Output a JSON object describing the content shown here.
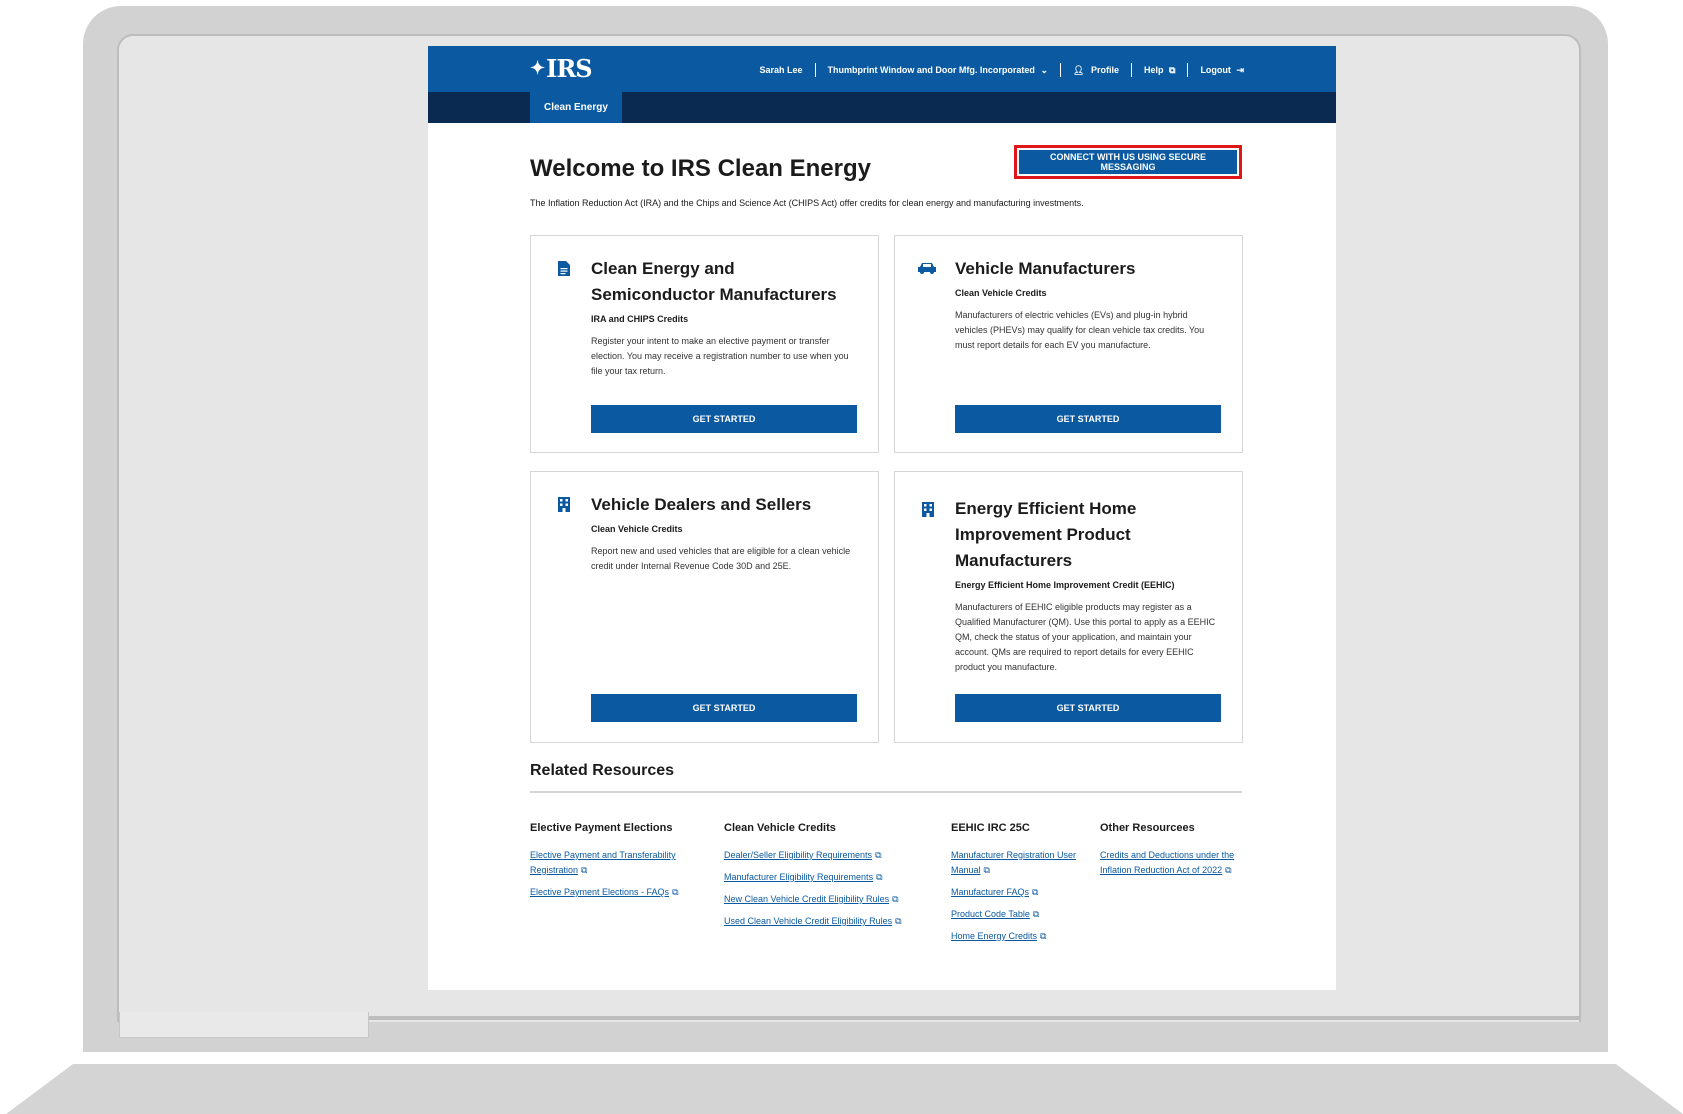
{
  "header": {
    "logo_text": "IRS",
    "user_name": "Sarah Lee",
    "organization": "Thumbprint Window and Door Mfg. Incorporated",
    "profile_label": "Profile",
    "help_label": "Help",
    "logout_label": "Logout"
  },
  "subnav": {
    "active_tab": "Clean Energy"
  },
  "main": {
    "title": "Welcome to IRS Clean Energy",
    "secure_messaging_label": "CONNECT WITH US USING SECURE MESSAGING",
    "intro": "The Inflation Reduction Act (IRA) and the Chips and Science Act (CHIPS Act) offer credits for clean energy and manufacturing investments."
  },
  "cards": [
    {
      "title": "Clean Energy and Semiconductor Manufacturers",
      "subtitle": "IRA and CHIPS Credits",
      "description": "Register your intent to make an elective payment or transfer election. You may receive a registration number to use when you file your tax return.",
      "button": "GET STARTED",
      "icon": "document-icon"
    },
    {
      "title": "Vehicle Manufacturers",
      "subtitle": "Clean Vehicle Credits",
      "description": "Manufacturers of electric vehicles (EVs) and plug-in hybrid vehicles (PHEVs) may qualify for clean vehicle tax credits. You must report details for each EV you manufacture.",
      "button": "GET STARTED",
      "icon": "car-icon"
    },
    {
      "title": "Vehicle Dealers and Sellers",
      "subtitle": "Clean Vehicle Credits",
      "description": "Report new and used vehicles that are eligible for a clean vehicle credit under Internal Revenue Code 30D and 25E.",
      "button": "GET STARTED",
      "icon": "building-icon"
    },
    {
      "title": "Energy Efficient Home Improvement Product Manufacturers",
      "subtitle": "Energy Efficient Home Improvement Credit (EEHIC)",
      "description": "Manufacturers of EEHIC eligible products may register as a Qualified Manufacturer (QM). Use this portal to apply as a EEHIC QM, check the status of your application, and maintain your account. QMs are required to report details for every EEHIC product you manufacture.",
      "button": "GET STARTED",
      "icon": "building-icon"
    }
  ],
  "resources": {
    "title": "Related Resources",
    "columns": [
      {
        "heading": "Elective Payment Elections",
        "links": [
          "Elective Payment and Transferability Registration",
          "Elective Payment Elections - FAQs"
        ]
      },
      {
        "heading": "Clean Vehicle Credits",
        "links": [
          "Dealer/Seller Eligibility Requirements",
          "Manufacturer Eligibility Requirements",
          "New Clean Vehicle Credit Eligibility Rules",
          "Used Clean Vehicle Credit Eligibility Rules"
        ]
      },
      {
        "heading": "EEHIC IRC 25C",
        "links": [
          "Manufacturer Registration User Manual",
          "Manufacturer FAQs",
          "Product Code Table",
          "Home Energy Credits"
        ]
      },
      {
        "heading": "Other Resourcees",
        "links": [
          "Credits and Deductions under the Inflation Reduction Act of 2022"
        ]
      }
    ]
  },
  "colors": {
    "header_blue": "#0b5aa1",
    "subnav_navy": "#0b2a52",
    "highlight_red": "#e0161b"
  }
}
